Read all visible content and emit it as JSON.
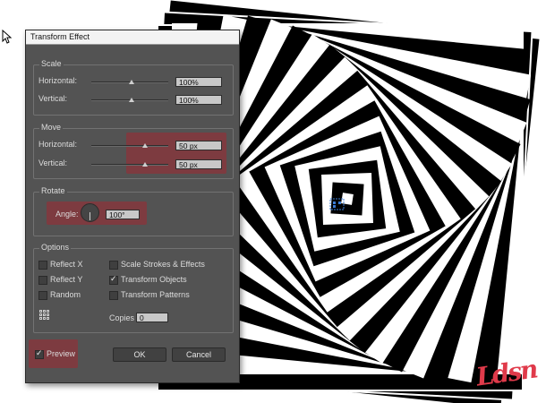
{
  "dialog": {
    "title": "Transform Effect",
    "scale": {
      "label": "Scale",
      "horizontal_label": "Horizontal:",
      "horizontal_value": "100%",
      "vertical_label": "Vertical:",
      "vertical_value": "100%"
    },
    "move": {
      "label": "Move",
      "horizontal_label": "Horizontal:",
      "horizontal_value": "50 px",
      "vertical_label": "Vertical:",
      "vertical_value": "50 px"
    },
    "rotate": {
      "label": "Rotate",
      "angle_label": "Angle:",
      "angle_value": "100°"
    },
    "options": {
      "label": "Options",
      "reflect_x": {
        "label": "Reflect X",
        "checked": false
      },
      "reflect_y": {
        "label": "Reflect Y",
        "checked": false
      },
      "random": {
        "label": "Random",
        "checked": false
      },
      "scale_strokes": {
        "label": "Scale Strokes & Effects",
        "checked": false
      },
      "transform_objects": {
        "label": "Transform Objects",
        "checked": true
      },
      "transform_patterns": {
        "label": "Transform Patterns",
        "checked": false
      },
      "copies_label": "Copies",
      "copies_value": "0"
    },
    "preview": {
      "label": "Preview",
      "checked": true
    },
    "ok_label": "OK",
    "cancel_label": "Cancel"
  },
  "colors": {
    "highlight": "#a02832",
    "dialog_bg": "#535353",
    "signature": "#e03a4a"
  },
  "watermark": "Ldsn"
}
